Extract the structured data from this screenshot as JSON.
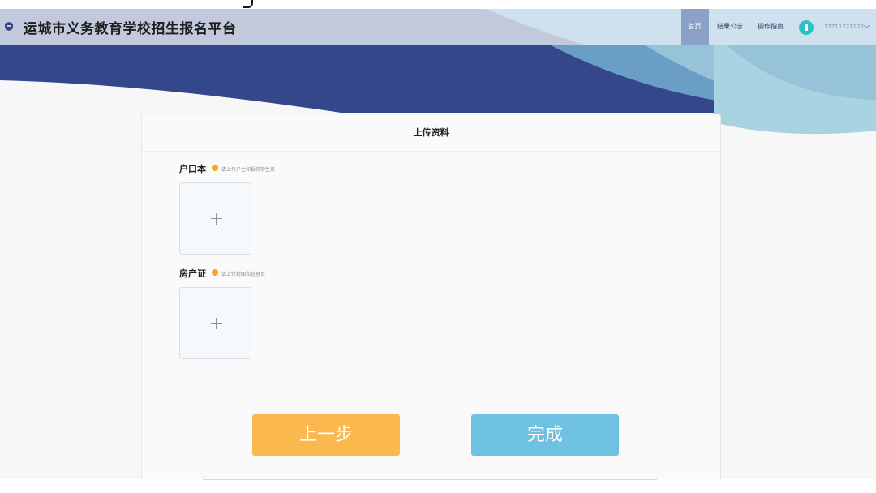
{
  "header": {
    "app_title": "运城市义务教育学校招生报名平台",
    "nav": {
      "home": "首页",
      "results": "结果公示",
      "guide": "操作指南"
    },
    "user": {
      "phone": "13711221122"
    }
  },
  "card": {
    "title": "上传资料",
    "fields": [
      {
        "label": "户口本",
        "hint": "请上传户主和报名学生页"
      },
      {
        "label": "房产证",
        "hint": "请上传封面和信息页"
      }
    ]
  },
  "buttons": {
    "prev": "上一步",
    "done": "完成"
  },
  "colors": {
    "banner_navy": "#34478a",
    "header_bar": "#c3c9dc",
    "nav_active": "#8aa2c8",
    "warn": "#f5a623",
    "btn_prev": "#fbb84e",
    "btn_done": "#6ec1e0"
  },
  "icons": [
    "shield-logo-icon",
    "avatar-icon",
    "chevron-down-icon",
    "warning-dot-icon",
    "plus-icon"
  ]
}
